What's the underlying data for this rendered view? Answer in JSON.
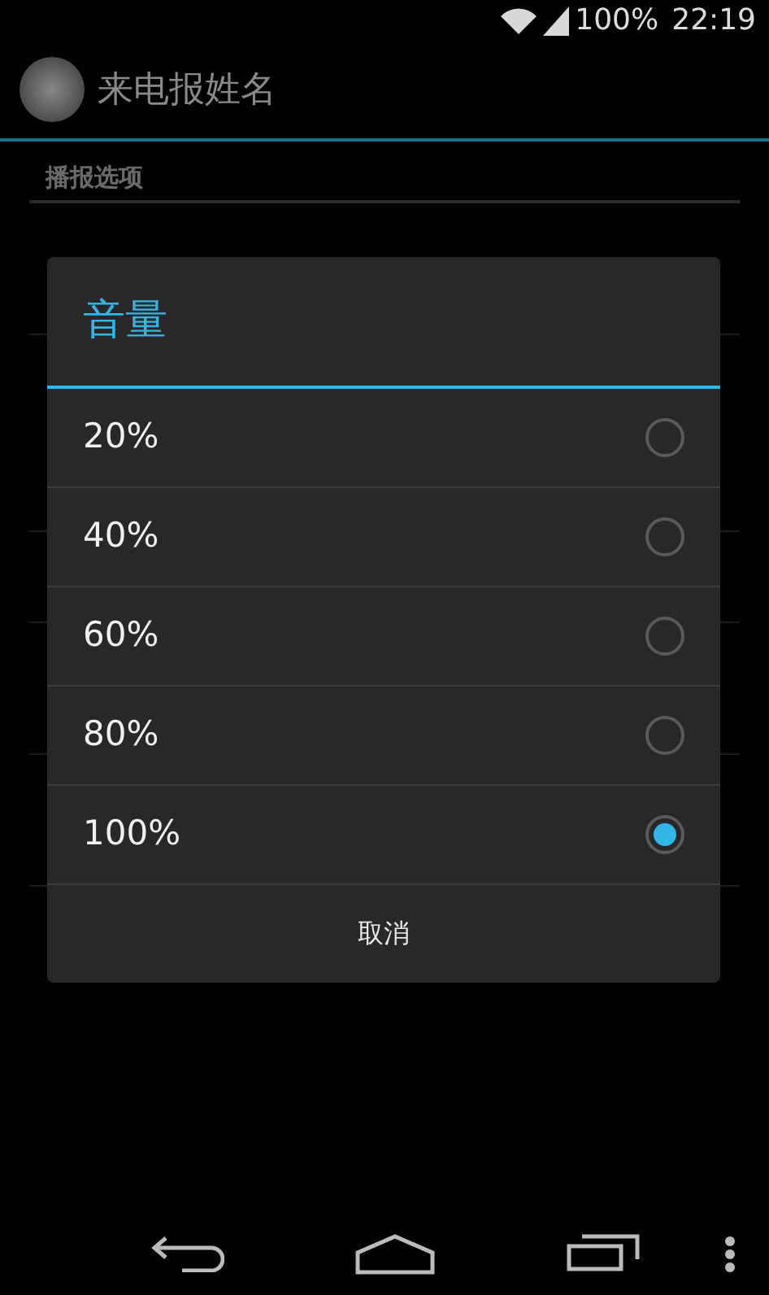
{
  "status_bar": {
    "battery": "100%",
    "time": "22:19"
  },
  "action_bar": {
    "title": "来电报姓名"
  },
  "section_header": "播报选项",
  "dialog": {
    "title": "音量",
    "options": [
      {
        "label": "20%",
        "selected": false
      },
      {
        "label": "40%",
        "selected": false
      },
      {
        "label": "60%",
        "selected": false
      },
      {
        "label": "80%",
        "selected": false
      },
      {
        "label": "100%",
        "selected": true
      }
    ],
    "cancel_button": "取消"
  }
}
